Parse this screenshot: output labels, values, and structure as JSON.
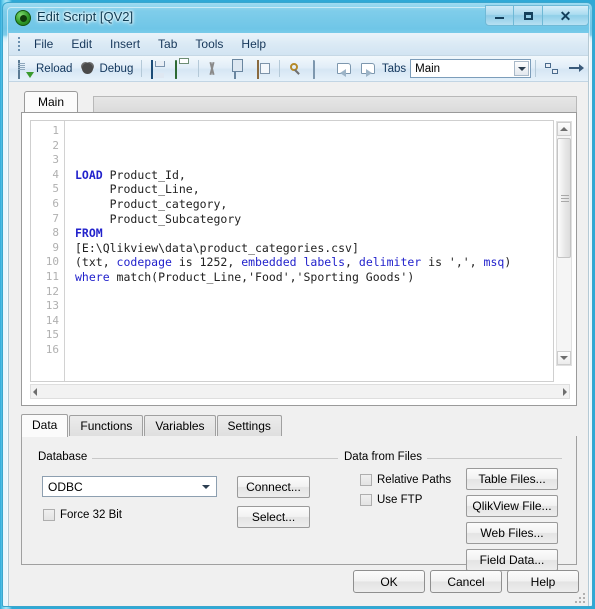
{
  "window": {
    "title": "Edit Script [QV2]",
    "icon": "qlikview-ball-icon",
    "minimize_label": "–",
    "maximize_label": "",
    "close_label": "✕"
  },
  "menubar": {
    "items": [
      {
        "label": "File"
      },
      {
        "label": "Edit"
      },
      {
        "label": "Insert"
      },
      {
        "label": "Tab"
      },
      {
        "label": "Tools"
      },
      {
        "label": "Help"
      }
    ]
  },
  "toolbar": {
    "reload_label": "Reload",
    "debug_label": "Debug",
    "tabs_label": "Tabs",
    "tabs_combo_value": "Main",
    "icons": [
      "reload-icon",
      "debug-icon",
      "save-icon",
      "print-icon",
      "cut-icon",
      "copy-icon",
      "paste-icon",
      "search-icon",
      "open-folder-icon",
      "prev-tab-icon",
      "next-tab-icon",
      "reorder-tabs-icon",
      "goto-icon"
    ]
  },
  "script_tabs": {
    "tabs": [
      {
        "label": "Main",
        "active": true
      }
    ]
  },
  "editor": {
    "line_numbers": [
      "1",
      "2",
      "3",
      "4",
      "5",
      "6",
      "7",
      "8",
      "9",
      "10",
      "11",
      "12",
      "13",
      "14",
      "15",
      "16"
    ],
    "lines": [
      {
        "num": "1",
        "tokens": []
      },
      {
        "num": "2",
        "tokens": []
      },
      {
        "num": "3",
        "tokens": []
      },
      {
        "num": "4",
        "tokens": [
          {
            "t": "LOAD",
            "c": "kw"
          },
          {
            "t": " Product_Id,",
            "c": "plain"
          }
        ]
      },
      {
        "num": "5",
        "tokens": [
          {
            "t": "     Product_Line,",
            "c": "plain"
          }
        ]
      },
      {
        "num": "6",
        "tokens": [
          {
            "t": "     Product_category,",
            "c": "plain"
          }
        ]
      },
      {
        "num": "7",
        "tokens": [
          {
            "t": "     Product_Subcategory",
            "c": "plain"
          }
        ]
      },
      {
        "num": "8",
        "tokens": [
          {
            "t": "FROM",
            "c": "kw"
          }
        ]
      },
      {
        "num": "9",
        "tokens": [
          {
            "t": "[E:\\Qlikview\\data\\product_categories.csv]",
            "c": "plain"
          }
        ]
      },
      {
        "num": "10",
        "tokens": [
          {
            "t": "(txt, ",
            "c": "plain"
          },
          {
            "t": "codepage",
            "c": "kw2"
          },
          {
            "t": " is 1252, ",
            "c": "plain"
          },
          {
            "t": "embedded labels",
            "c": "kw2"
          },
          {
            "t": ", ",
            "c": "plain"
          },
          {
            "t": "delimiter",
            "c": "kw2"
          },
          {
            "t": " is ',', ",
            "c": "plain"
          },
          {
            "t": "msq",
            "c": "kw2"
          },
          {
            "t": ")",
            "c": "plain"
          }
        ]
      },
      {
        "num": "11",
        "tokens": [
          {
            "t": "where",
            "c": "kw2"
          },
          {
            "t": " match(Product_Line,'Food','Sporting Goods')",
            "c": "plain"
          }
        ]
      },
      {
        "num": "12",
        "tokens": []
      },
      {
        "num": "13",
        "tokens": []
      },
      {
        "num": "14",
        "tokens": []
      },
      {
        "num": "15",
        "tokens": []
      },
      {
        "num": "16",
        "tokens": []
      }
    ]
  },
  "bottom_tabs": {
    "tabs": [
      {
        "label": "Data",
        "active": true
      },
      {
        "label": "Functions",
        "active": false
      },
      {
        "label": "Variables",
        "active": false
      },
      {
        "label": "Settings",
        "active": false
      }
    ]
  },
  "database_group": {
    "title": "Database",
    "combo_value": "ODBC",
    "connect_button": "Connect...",
    "select_button": "Select...",
    "force32_checkbox": {
      "label": "Force 32 Bit",
      "checked": false
    }
  },
  "files_group": {
    "title": "Data from Files",
    "relative_paths_checkbox": {
      "label": "Relative Paths",
      "checked": false
    },
    "use_ftp_checkbox": {
      "label": "Use FTP",
      "checked": false
    },
    "table_files_button": "Table Files...",
    "qlikview_file_button": "QlikView File...",
    "web_files_button": "Web Files...",
    "field_data_button": "Field Data..."
  },
  "footer": {
    "ok_button": "OK",
    "cancel_button": "Cancel",
    "help_button": "Help"
  }
}
